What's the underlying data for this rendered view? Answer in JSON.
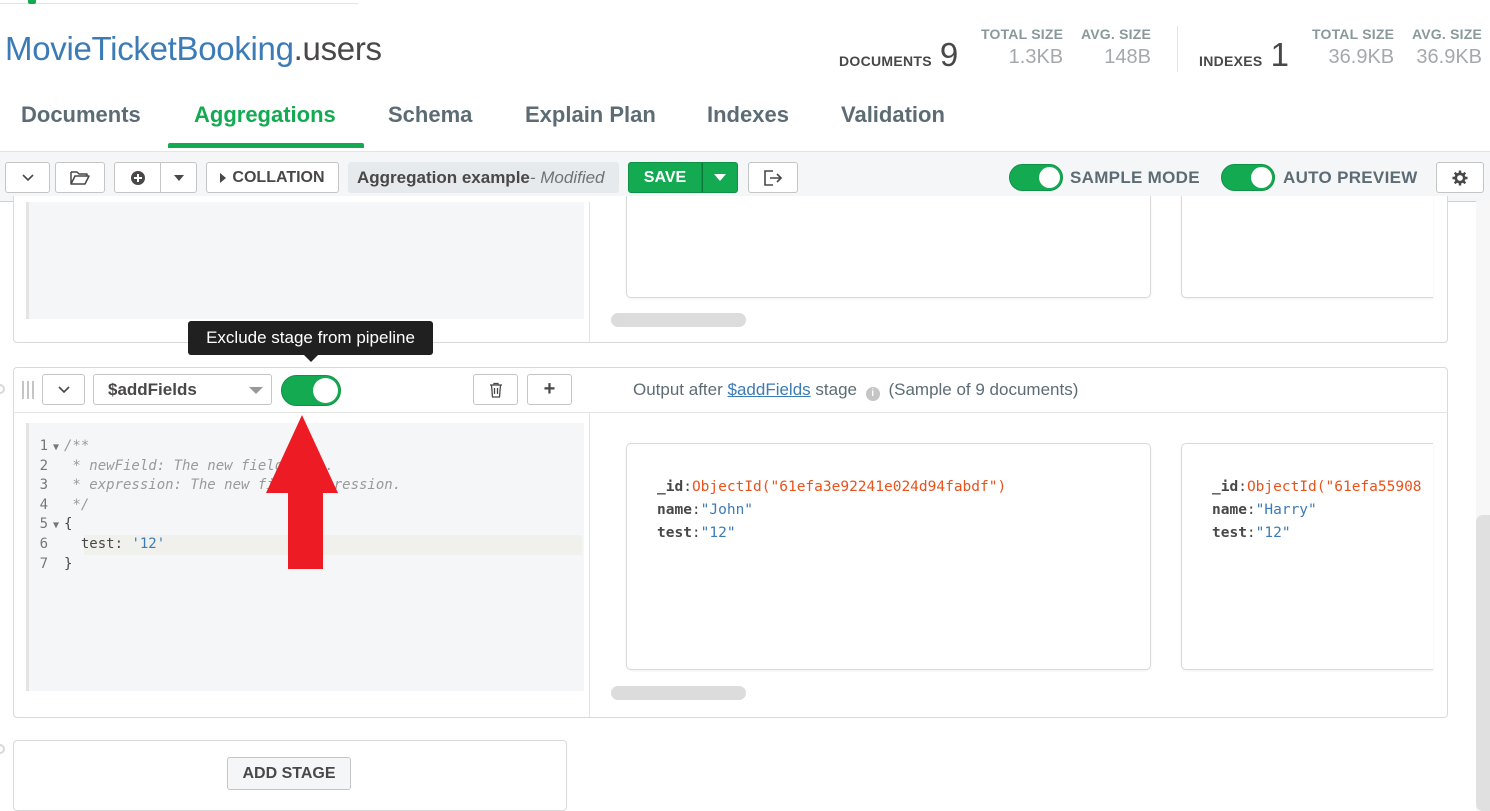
{
  "header": {
    "db_name": "MovieTicketBooking",
    "collection_name": ".users",
    "documents_label": "DOCUMENTS",
    "documents_count": "9",
    "doc_total_size_label": "TOTAL SIZE",
    "doc_total_size": "1.3KB",
    "doc_avg_size_label": "AVG. SIZE",
    "doc_avg_size": "148B",
    "indexes_label": "INDEXES",
    "indexes_count": "1",
    "idx_total_size_label": "TOTAL SIZE",
    "idx_total_size": "36.9KB",
    "idx_avg_size_label": "AVG. SIZE",
    "idx_avg_size": "36.9KB"
  },
  "tabs": [
    {
      "label": "Documents",
      "active": false
    },
    {
      "label": "Aggregations",
      "active": true
    },
    {
      "label": "Schema",
      "active": false
    },
    {
      "label": "Explain Plan",
      "active": false
    },
    {
      "label": "Indexes",
      "active": false
    },
    {
      "label": "Validation",
      "active": false
    }
  ],
  "toolbar": {
    "collation_label": "COLLATION",
    "pipeline_name": "Aggregation example",
    "pipeline_modified": "- Modified",
    "save_label": "SAVE",
    "sample_mode_label": "SAMPLE MODE",
    "auto_preview_label": "AUTO PREVIEW"
  },
  "tooltip": {
    "text": "Exclude stage from pipeline"
  },
  "stage": {
    "operator": "$addFields",
    "enabled": true,
    "delete_icon": "trash-icon",
    "add_icon": "plus-icon",
    "output_prefix": "Output after ",
    "output_link": "$addFields",
    "output_suffix": " stage",
    "sample_text": "(Sample of 9 documents)",
    "code_lines": [
      {
        "n": "1",
        "fold": true,
        "text": "/**",
        "type": "comment"
      },
      {
        "n": "2",
        "fold": false,
        "text": " * newField: The new field name.",
        "type": "comment"
      },
      {
        "n": "3",
        "fold": false,
        "text": " * expression: The new field expression.",
        "type": "comment"
      },
      {
        "n": "4",
        "fold": false,
        "text": " */",
        "type": "comment"
      },
      {
        "n": "5",
        "fold": true,
        "text": "{",
        "type": "text"
      },
      {
        "n": "6",
        "fold": false,
        "text": "  test: ",
        "type": "text",
        "str": "'12'"
      },
      {
        "n": "7",
        "fold": false,
        "text": "}",
        "type": "text"
      }
    ],
    "documents": [
      {
        "id_key": "_id",
        "id_value": "ObjectId(\"61efa3e92241e024d94fabdf\")",
        "name_key": "name",
        "name_value": "\"John\"",
        "test_key": "test",
        "test_value": "\"12\""
      },
      {
        "id_key": "_id",
        "id_value": "ObjectId(\"61efa55908",
        "name_key": "name",
        "name_value": "\"Harry\"",
        "test_key": "test",
        "test_value": "\"12\""
      }
    ]
  },
  "add_stage_label": "ADD STAGE",
  "colors": {
    "accent": "#13aa52",
    "link": "#3c7bb6",
    "objectid": "#e8531d",
    "annotation_arrow": "#ed1c24"
  }
}
